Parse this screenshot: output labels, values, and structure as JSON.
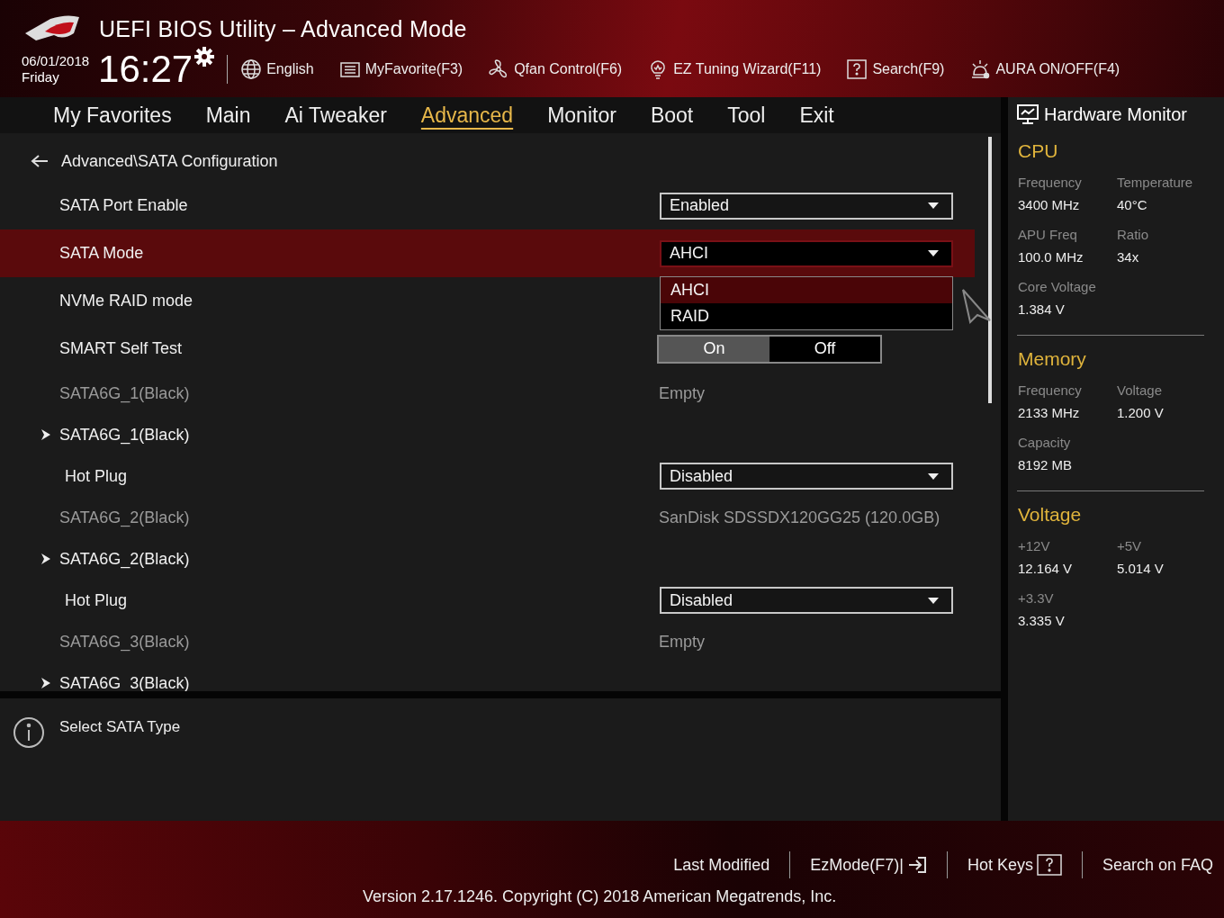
{
  "header": {
    "title": "UEFI BIOS Utility – Advanced Mode",
    "date": "06/01/2018",
    "day": "Friday",
    "time": "16:27",
    "tools": [
      {
        "kind": "globe",
        "label": "English"
      },
      {
        "kind": "list",
        "label": "MyFavorite(F3)"
      },
      {
        "kind": "fan",
        "label": "Qfan Control(F6)"
      },
      {
        "kind": "bulb",
        "label": "EZ Tuning Wizard(F11)"
      },
      {
        "kind": "help",
        "label": "Search(F9)"
      },
      {
        "kind": "aura",
        "label": "AURA ON/OFF(F4)"
      }
    ]
  },
  "tabs": [
    {
      "label": "My Favorites",
      "selected": false
    },
    {
      "label": "Main",
      "selected": false
    },
    {
      "label": "Ai Tweaker",
      "selected": false
    },
    {
      "label": "Advanced",
      "selected": true
    },
    {
      "label": "Monitor",
      "selected": false
    },
    {
      "label": "Boot",
      "selected": false
    },
    {
      "label": "Tool",
      "selected": false
    },
    {
      "label": "Exit",
      "selected": false
    }
  ],
  "breadcrumb": "Advanced\\SATA Configuration",
  "settings": [
    {
      "kind": "dropdown",
      "label": "SATA Port Enable",
      "value": "Enabled",
      "selected": false
    },
    {
      "kind": "dropdown",
      "label": "SATA Mode",
      "value": "AHCI",
      "selected": true,
      "options": [
        {
          "label": "AHCI",
          "selected": true
        },
        {
          "label": "RAID",
          "selected": false
        }
      ]
    },
    {
      "kind": "plain",
      "label": "NVMe RAID mode",
      "selected": false
    },
    {
      "kind": "toggle",
      "label": "SMART Self Test",
      "selected": false,
      "options": [
        {
          "label": "On",
          "selected": true
        },
        {
          "label": "Off",
          "selected": false
        }
      ]
    },
    {
      "kind": "info",
      "label": "SATA6G_1(Black)",
      "value": "Empty",
      "selected": false
    },
    {
      "kind": "submenu",
      "label": "SATA6G_1(Black)",
      "selected": false
    },
    {
      "kind": "subdropdown",
      "label": "Hot Plug",
      "value": "Disabled",
      "selected": false
    },
    {
      "kind": "info",
      "label": "SATA6G_2(Black)",
      "value": "SanDisk SDSSDX120GG25 (120.0GB)",
      "selected": false
    },
    {
      "kind": "submenu",
      "label": "SATA6G_2(Black)",
      "selected": false
    },
    {
      "kind": "subdropdown",
      "label": "Hot Plug",
      "value": "Disabled",
      "selected": false
    },
    {
      "kind": "info",
      "label": "SATA6G_3(Black)",
      "value": "Empty",
      "selected": false
    },
    {
      "kind": "submenu",
      "label": "SATA6G_3(Black)",
      "selected": false
    }
  ],
  "help_text": "Select SATA Type",
  "hardware_monitor": {
    "title": "Hardware Monitor",
    "sections": [
      {
        "title": "CPU",
        "items": [
          {
            "label": "Frequency",
            "value": "3400 MHz"
          },
          {
            "label": "Temperature",
            "value": "40°C"
          },
          {
            "label": "APU Freq",
            "value": "100.0 MHz"
          },
          {
            "label": "Ratio",
            "value": "34x"
          },
          {
            "label": "Core Voltage",
            "value": "1.384 V"
          }
        ]
      },
      {
        "title": "Memory",
        "items": [
          {
            "label": "Frequency",
            "value": "2133 MHz"
          },
          {
            "label": "Voltage",
            "value": "1.200 V"
          },
          {
            "label": "Capacity",
            "value": "8192 MB"
          }
        ]
      },
      {
        "title": "Voltage",
        "items": [
          {
            "label": "+12V",
            "value": "12.164 V"
          },
          {
            "label": "+5V",
            "value": "5.014 V"
          },
          {
            "label": "+3.3V",
            "value": "3.335 V"
          }
        ]
      }
    ]
  },
  "footer": {
    "links": [
      {
        "kind": "text",
        "label": "Last Modified"
      },
      {
        "kind": "exit",
        "label": "EzMode(F7)|"
      },
      {
        "kind": "help",
        "label": "Hot Keys"
      },
      {
        "kind": "text",
        "label": "Search on FAQ"
      }
    ],
    "version": "Version 2.17.1246. Copyright (C) 2018 American Megatrends, Inc."
  }
}
